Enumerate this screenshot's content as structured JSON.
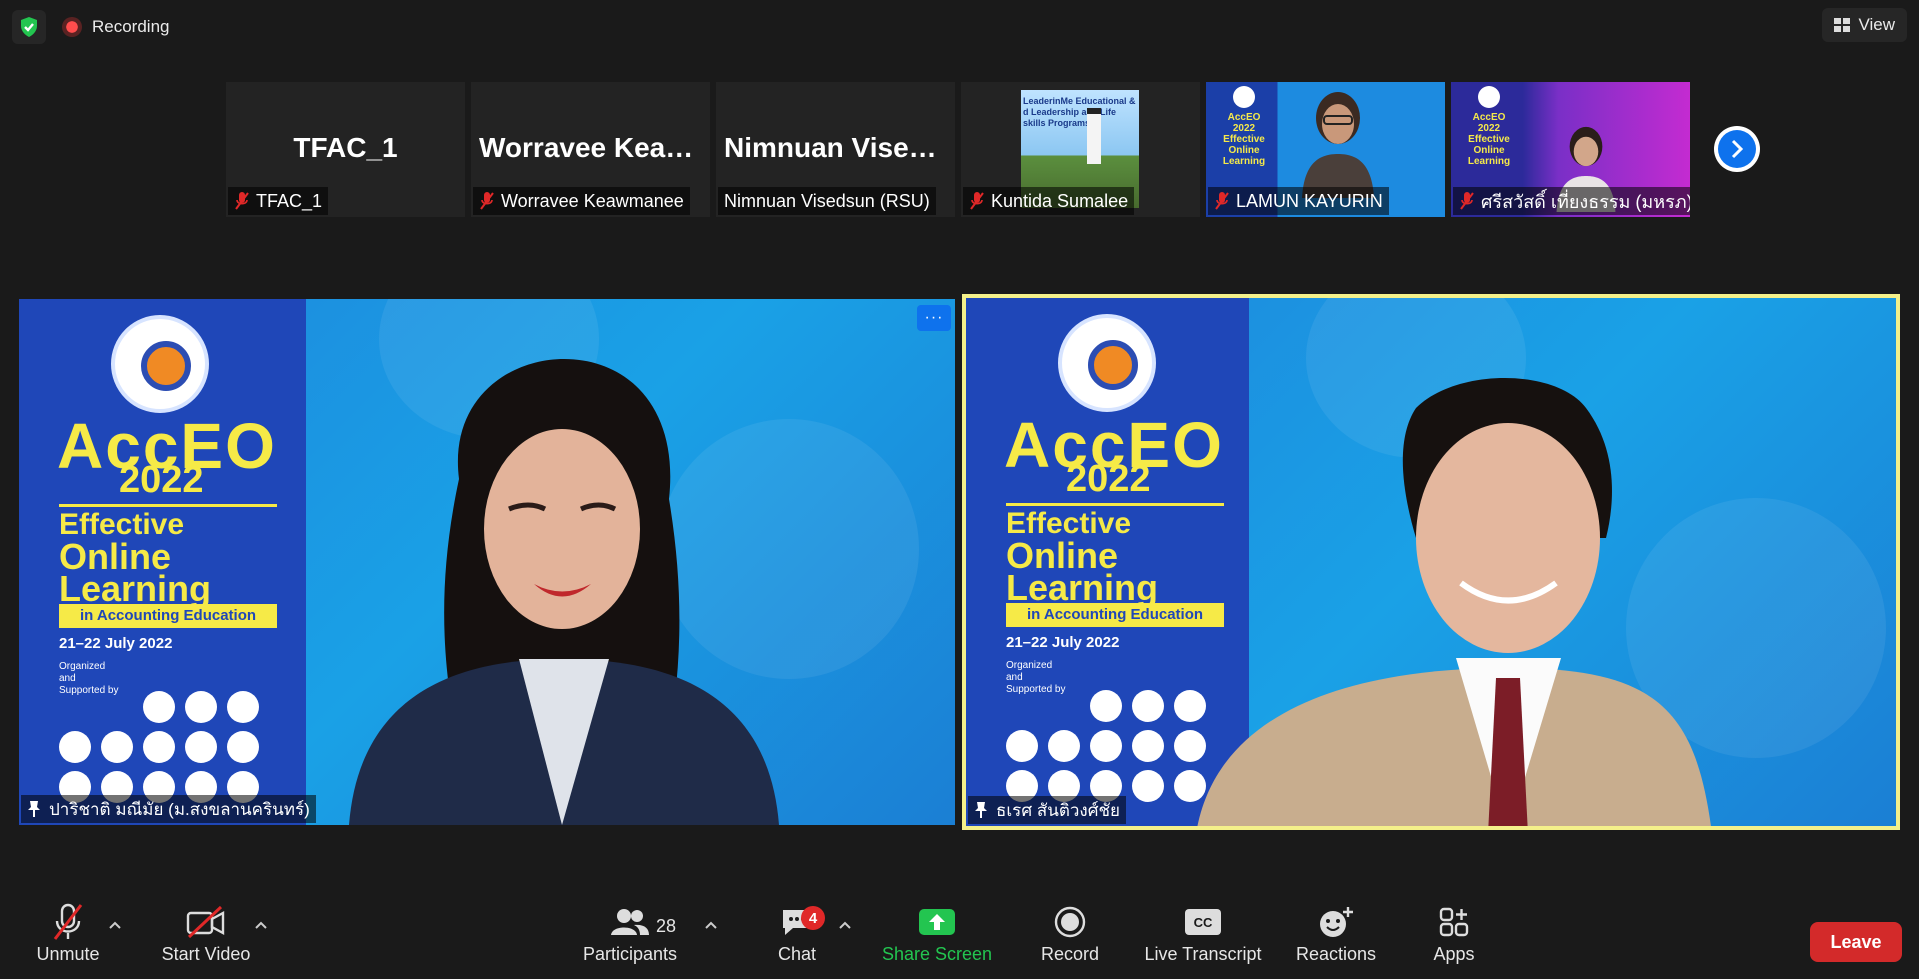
{
  "topbar": {
    "recording_label": "Recording",
    "view_label": "View"
  },
  "thumbnails": [
    {
      "big_name": "TFAC_1",
      "label": "TFAC_1",
      "muted": true
    },
    {
      "big_name": "Worravee  Keaw…",
      "label": "Worravee Keawmanee",
      "muted": true
    },
    {
      "big_name": "Nimnuan  Vised…",
      "label": "Nimnuan Visedsun (RSU)",
      "muted": false
    },
    {
      "label": "Kuntida Sumalee",
      "muted": true,
      "image_text": "LeaderinMe Educational & d Leadership and Life skills Programs"
    },
    {
      "label": "LAMUN KAYURIN",
      "muted": true,
      "poster_text": [
        "AccEO",
        "2022",
        "Effective",
        "Online",
        "Learning"
      ]
    },
    {
      "label": "ศรีสวัสดิ์ เที่ยงธรรม (มหรภ)",
      "muted": true,
      "poster_text": [
        "AccEO",
        "2022",
        "Effective",
        "Online",
        "Learning"
      ]
    }
  ],
  "videos": {
    "left": {
      "name": "ปาริชาติ มณีมัย (ม.สงขลานครินทร์)",
      "more": "···"
    },
    "right": {
      "name": "ธเรศ สันติวงศ์ชัย"
    }
  },
  "poster": {
    "brand": "AccEO",
    "year": "2022",
    "line1": "Effective",
    "line2": "Online",
    "line3": "Learning",
    "subtitle": "in Accounting Education",
    "date": "21–22 July 2022",
    "organized": "Organized and Supported by"
  },
  "toolbar": {
    "unmute": "Unmute",
    "start_video": "Start Video",
    "participants": "Participants",
    "participants_count": "28",
    "chat": "Chat",
    "chat_badge": "4",
    "share_screen": "Share Screen",
    "record": "Record",
    "live_transcript": "Live Transcript",
    "reactions": "Reactions",
    "apps": "Apps",
    "leave": "Leave"
  },
  "colors": {
    "accent_blue": "#0e72ed",
    "share_green": "#23c550",
    "leave_red": "#d32a2a",
    "active_speaker_border": "#f4f08a"
  }
}
